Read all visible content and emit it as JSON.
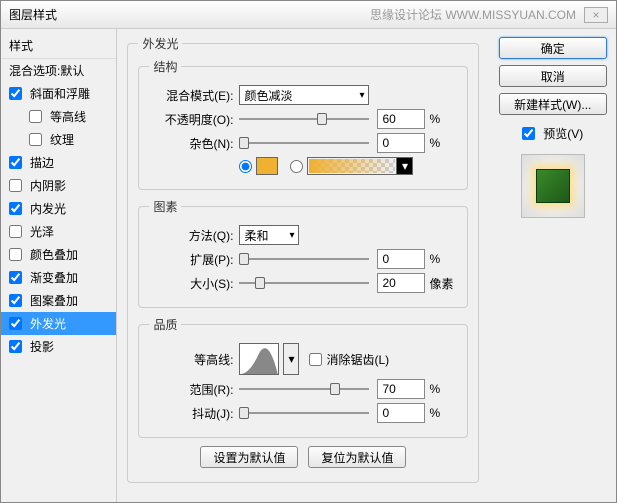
{
  "titlebar": {
    "title": "图层样式",
    "watermark": "思缘设计论坛  WWW.MISSYUAN.COM"
  },
  "sidebar": {
    "header": "样式",
    "blending": "混合选项:默认",
    "items": [
      {
        "label": "斜面和浮雕",
        "checked": true
      },
      {
        "label": "等高线",
        "checked": false,
        "sub": true
      },
      {
        "label": "纹理",
        "checked": false,
        "sub": true
      },
      {
        "label": "描边",
        "checked": true
      },
      {
        "label": "内阴影",
        "checked": false
      },
      {
        "label": "内发光",
        "checked": true
      },
      {
        "label": "光泽",
        "checked": false
      },
      {
        "label": "颜色叠加",
        "checked": false
      },
      {
        "label": "渐变叠加",
        "checked": true
      },
      {
        "label": "图案叠加",
        "checked": true
      },
      {
        "label": "外发光",
        "checked": true,
        "selected": true
      },
      {
        "label": "投影",
        "checked": true
      }
    ]
  },
  "panel": {
    "title": "外发光",
    "structure": {
      "legend": "结构",
      "blendmode_label": "混合模式(E):",
      "blendmode_value": "颜色减淡",
      "opacity_label": "不透明度(O):",
      "opacity_value": "60",
      "opacity_unit": "%",
      "noise_label": "杂色(N):",
      "noise_value": "0",
      "noise_unit": "%",
      "solid_color": "#f0b030"
    },
    "elements": {
      "legend": "图素",
      "technique_label": "方法(Q):",
      "technique_value": "柔和",
      "spread_label": "扩展(P):",
      "spread_value": "0",
      "spread_unit": "%",
      "size_label": "大小(S):",
      "size_value": "20",
      "size_unit": "像素"
    },
    "quality": {
      "legend": "品质",
      "contour_label": "等高线:",
      "antialias_label": "消除锯齿(L)",
      "range_label": "范围(R):",
      "range_value": "70",
      "range_unit": "%",
      "jitter_label": "抖动(J):",
      "jitter_value": "0",
      "jitter_unit": "%"
    },
    "reset_default": "设置为默认值",
    "restore_default": "复位为默认值"
  },
  "right": {
    "ok": "确定",
    "cancel": "取消",
    "newstyle": "新建样式(W)...",
    "preview": "预览(V)"
  }
}
